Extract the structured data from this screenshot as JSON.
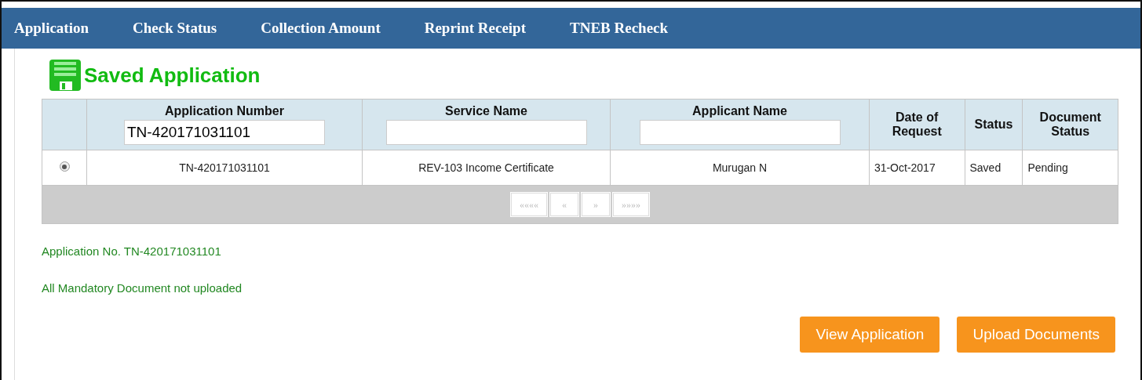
{
  "nav": [
    {
      "label": "Application"
    },
    {
      "label": "Check Status"
    },
    {
      "label": "Collection Amount"
    },
    {
      "label": "Reprint Receipt"
    },
    {
      "label": "TNEB Recheck"
    }
  ],
  "title": "Saved Application",
  "table": {
    "columns": [
      {
        "kind": "filter",
        "label": "Application Number",
        "filter": "TN-420171031101"
      },
      {
        "kind": "filter",
        "label": "Service Name"
      },
      {
        "kind": "filter",
        "label": "Applicant Name"
      },
      {
        "kind": "plain",
        "label": "Date of Request"
      },
      {
        "kind": "plain",
        "label": "Status"
      },
      {
        "kind": "plain",
        "label": "Document Status"
      }
    ],
    "rows": [
      {
        "selected": true,
        "cells": [
          "TN-420171031101",
          "REV-103 Income Certificate",
          "Murugan N",
          "31-Oct-2017",
          "Saved",
          "Pending"
        ]
      }
    ],
    "pager": [
      {
        "label": "««««",
        "disabled": true
      },
      {
        "label": "«",
        "disabled": true
      },
      {
        "label": "»",
        "disabled": true
      },
      {
        "label": "»»»»",
        "disabled": true
      }
    ]
  },
  "messages": [
    "Application No. TN-420171031101",
    "All Mandatory Document not uploaded"
  ],
  "buttons": [
    "View Application",
    "Upload Documents"
  ]
}
